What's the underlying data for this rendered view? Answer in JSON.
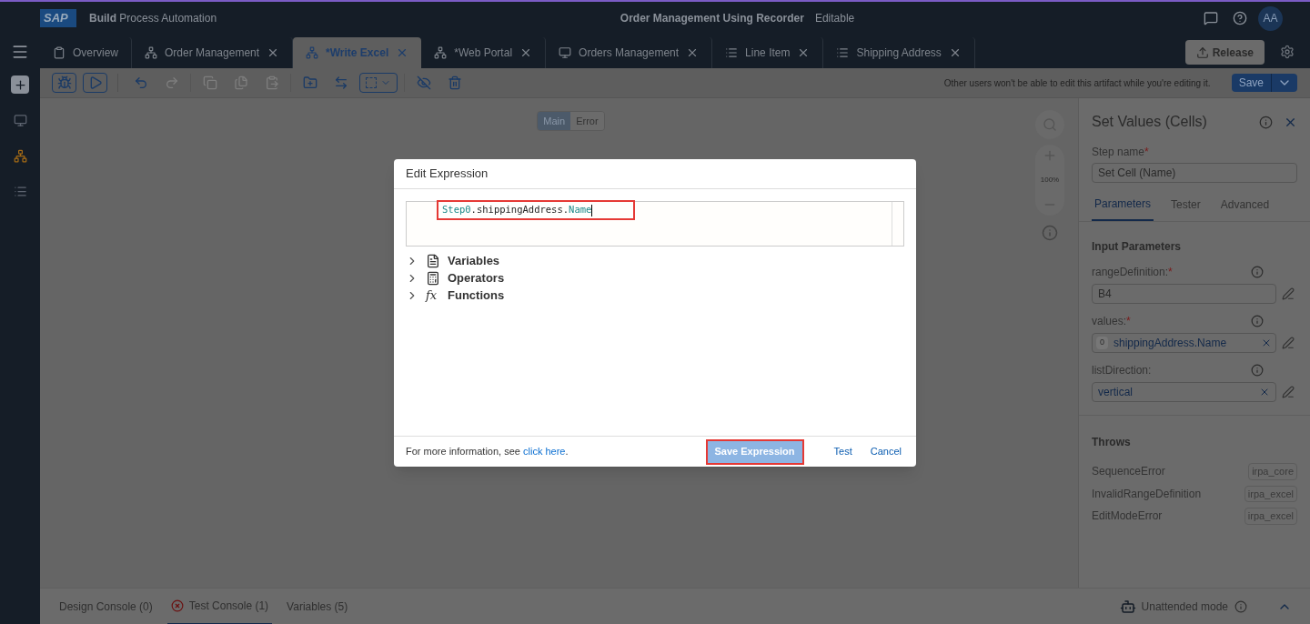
{
  "header": {
    "logo": "SAP",
    "product_bold": "Build",
    "product_rest": "Process Automation",
    "title": "Order Management Using Recorder",
    "status": "Editable",
    "avatar": "AA"
  },
  "tabs": [
    {
      "label": "Overview",
      "kind": "overview",
      "closable": false,
      "selected": false
    },
    {
      "label": "Order Management",
      "kind": "process",
      "closable": true,
      "selected": false
    },
    {
      "label": "*Write Excel",
      "kind": "process",
      "closable": true,
      "selected": true
    },
    {
      "label": "*Web Portal",
      "kind": "process",
      "closable": true,
      "selected": false
    },
    {
      "label": "Orders Management",
      "kind": "screen",
      "closable": true,
      "selected": false
    },
    {
      "label": "Line Item",
      "kind": "data",
      "closable": true,
      "selected": false
    },
    {
      "label": "Shipping Address",
      "kind": "data",
      "closable": true,
      "selected": false
    }
  ],
  "release_button": "Release",
  "rail": [
    {
      "kind": "create",
      "selected": false
    },
    {
      "kind": "screen",
      "selected": false
    },
    {
      "kind": "process",
      "selected": true
    },
    {
      "kind": "data",
      "selected": false
    }
  ],
  "toolbar": {
    "note": "Other users won't be able to edit this artifact while you're editing it.",
    "save": "Save"
  },
  "canvas": {
    "modes": [
      {
        "label": "Main",
        "selected": true
      },
      {
        "label": "Error",
        "selected": false
      }
    ],
    "zoom": "100%"
  },
  "dialog": {
    "title": "Edit Expression",
    "highlighted": true,
    "code": [
      {
        "text": "Step0",
        "kind": "identifier"
      },
      {
        "text": ".shippingAddress.",
        "kind": "plain"
      },
      {
        "text": "Name",
        "kind": "identifier"
      }
    ],
    "tree": [
      {
        "label": "Variables",
        "kind": "variables",
        "expanded": false
      },
      {
        "label": "Operators",
        "kind": "operators",
        "expanded": false
      },
      {
        "label": "Functions",
        "kind": "functions",
        "symbol": "fx",
        "expanded": false
      }
    ],
    "info": "For more information, see",
    "link": "click here",
    "info_end": ".",
    "buttons": [
      {
        "label": "Save Expression",
        "kind": "primary",
        "highlighted": true
      },
      {
        "label": "Test",
        "kind": "link",
        "highlighted": false
      },
      {
        "label": "Cancel",
        "kind": "link",
        "highlighted": false
      }
    ]
  },
  "panel": {
    "title": "Set Values (Cells)",
    "step_label": "Step name",
    "step_marker": "*",
    "step_value": "Set Cell (Name)",
    "tabs": [
      {
        "label": "Parameters",
        "selected": true
      },
      {
        "label": "Tester",
        "selected": false
      },
      {
        "label": "Advanced",
        "selected": false
      }
    ],
    "section": "Input Parameters",
    "params": [
      {
        "label": "rangeDefinition:",
        "marker": "*",
        "kind": "text",
        "value": "B4"
      },
      {
        "label": "values:",
        "marker": "*",
        "kind": "token",
        "index": "0",
        "value": "shippingAddress.Name"
      },
      {
        "label": "listDirection:",
        "kind": "chip",
        "value": "vertical"
      }
    ],
    "throws_title": "Throws",
    "throws": [
      {
        "name": "SequenceError",
        "module": "irpa_core"
      },
      {
        "name": "InvalidRangeDefinition",
        "module": "irpa_excel"
      },
      {
        "name": "EditModeError",
        "module": "irpa_excel"
      }
    ]
  },
  "bottom": {
    "tabs": [
      {
        "label": "Design Console (0)",
        "error": false,
        "selected": false
      },
      {
        "label": "Test Console (1)",
        "error": true,
        "selected": true
      },
      {
        "label": "Variables (5)",
        "error": false,
        "selected": false
      }
    ],
    "mode": "Unattended mode"
  }
}
